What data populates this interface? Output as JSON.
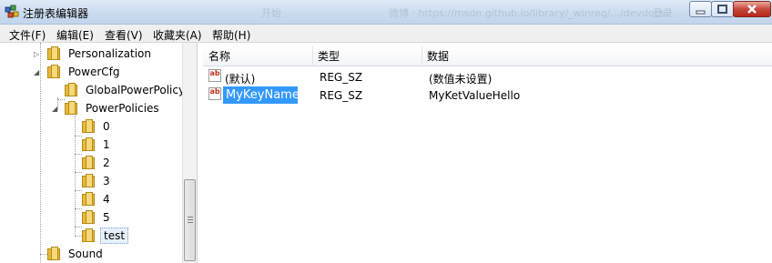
{
  "window": {
    "title": "注册表编辑器",
    "blurred_background_text": [
      "开始",
      "微博 · https://msdn.github.io/library/_winreg/.../devdocs",
      "登录"
    ]
  },
  "menu": [
    "文件(F)",
    "编辑(E)",
    "查看(V)",
    "收藏夹(A)",
    "帮助(H)"
  ],
  "tree": {
    "items": [
      {
        "label": "Personalization"
      },
      {
        "label": "PowerCfg"
      },
      {
        "label": "GlobalPowerPolicy"
      },
      {
        "label": "PowerPolicies"
      },
      {
        "label": "0"
      },
      {
        "label": "1"
      },
      {
        "label": "2"
      },
      {
        "label": "3"
      },
      {
        "label": "4"
      },
      {
        "label": "5"
      },
      {
        "label": "test",
        "selected": true
      },
      {
        "label": "Sound"
      }
    ]
  },
  "list": {
    "columns": [
      "名称",
      "类型",
      "数据"
    ],
    "rows": [
      {
        "name": "(默认)",
        "type": "REG_SZ",
        "data": "(数值未设置)"
      },
      {
        "name": "MyKeyName",
        "type": "REG_SZ",
        "data": "MyKetValueHello",
        "editing": true
      }
    ]
  },
  "colors": {
    "selection": "#3399ff",
    "titlebar": "#c9daee",
    "folder": "#e8b93b"
  }
}
